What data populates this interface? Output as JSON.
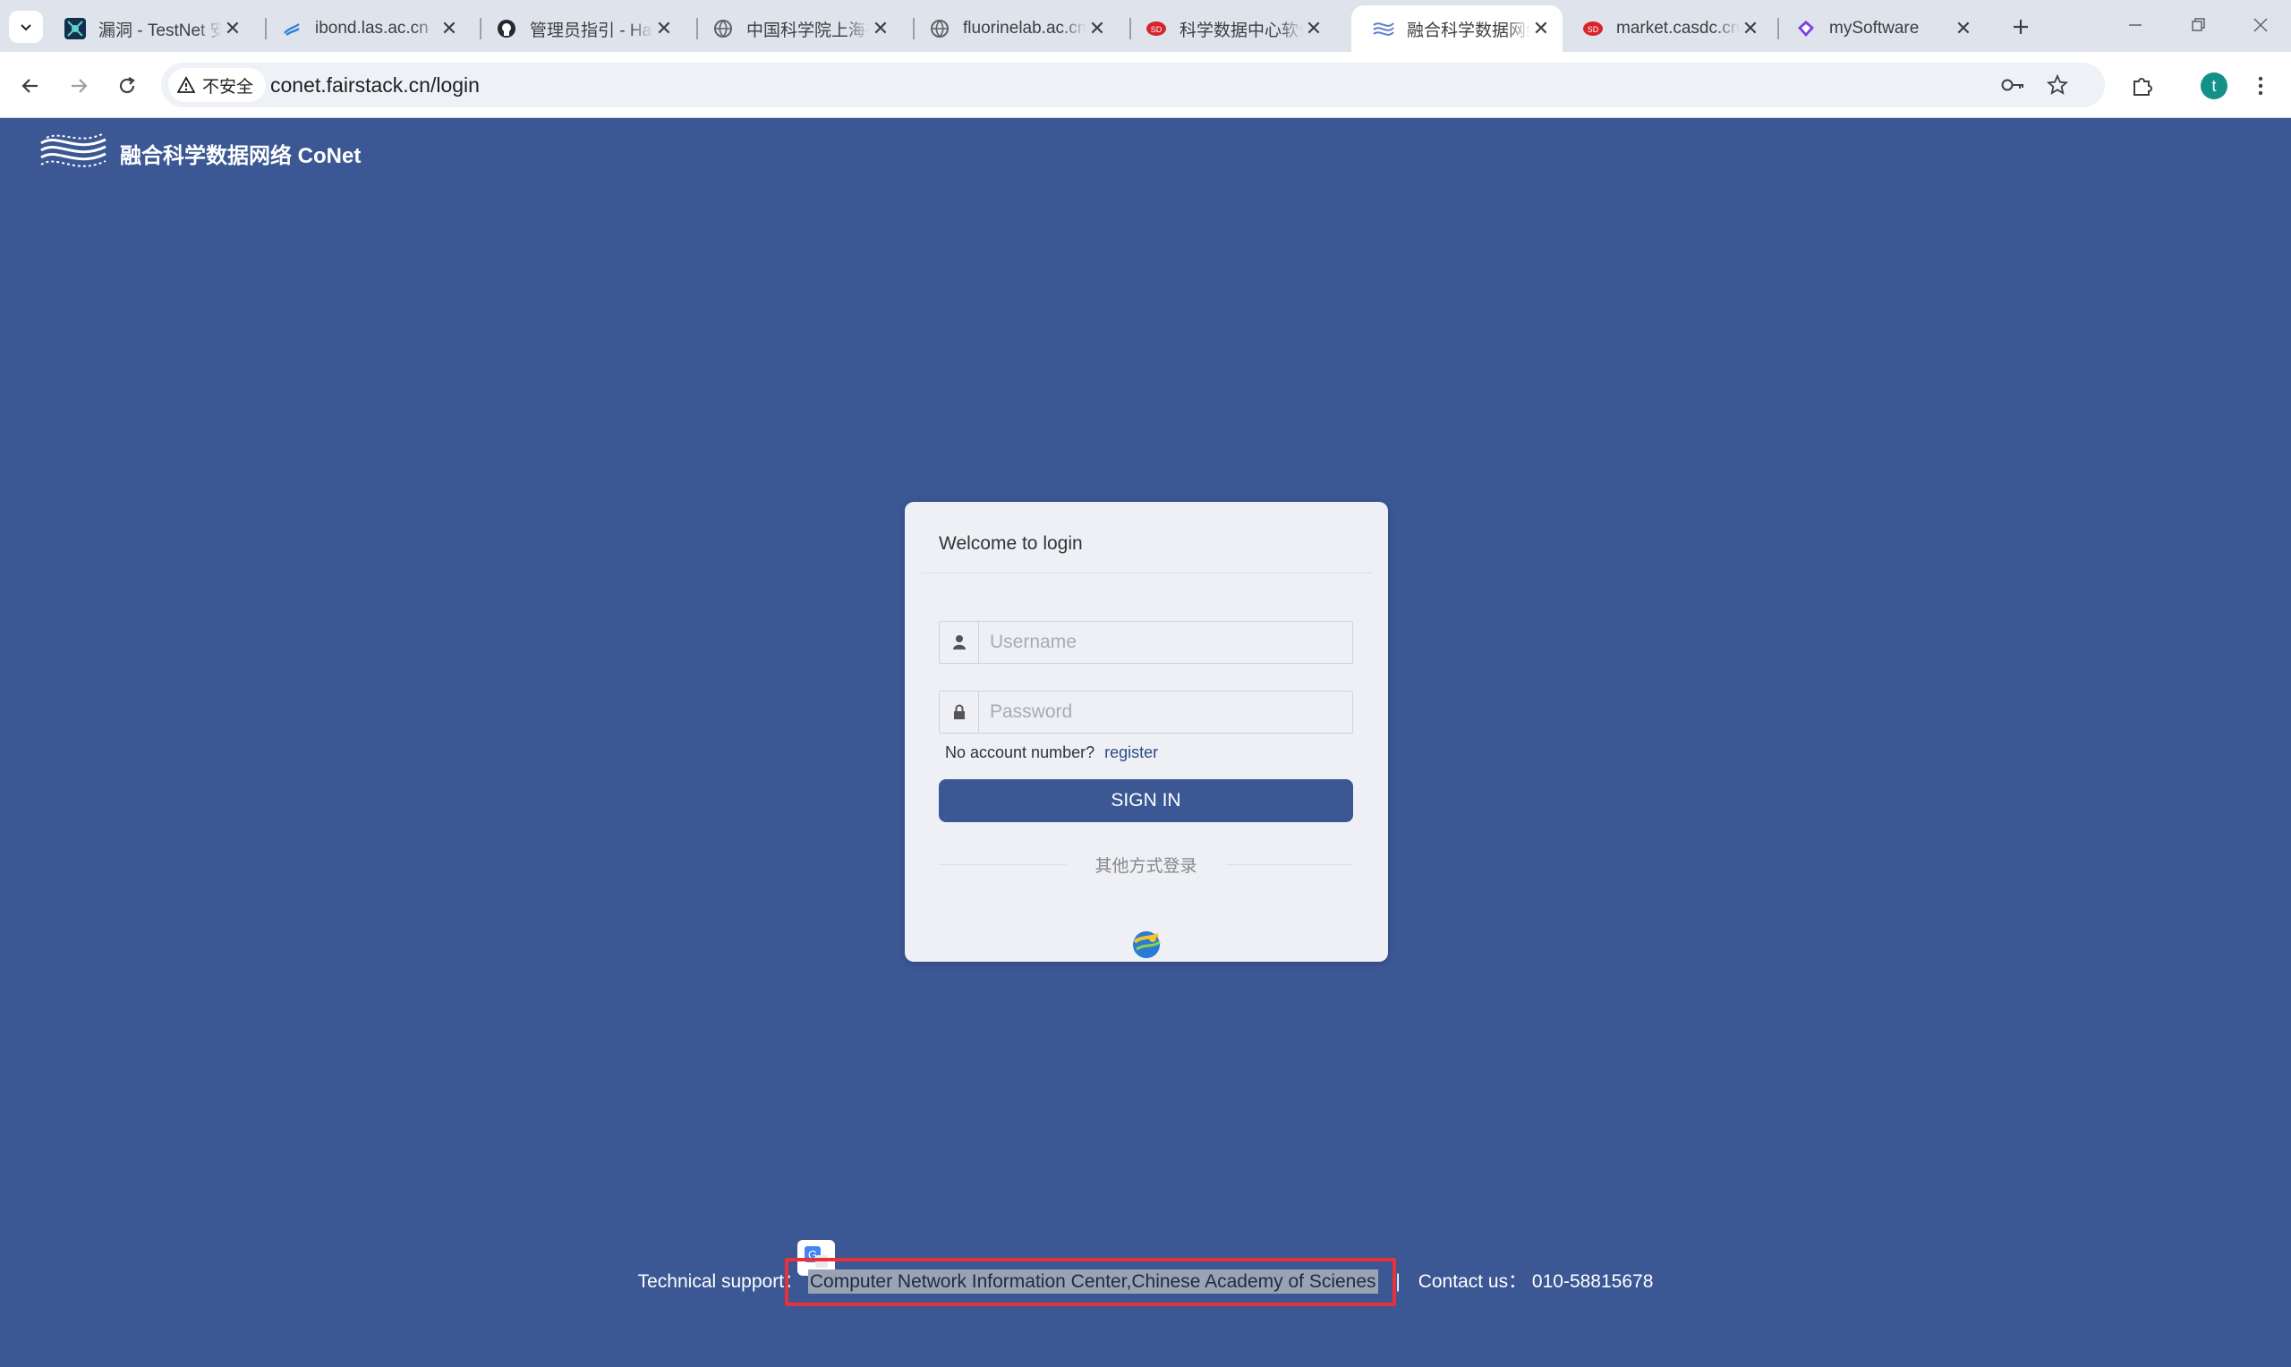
{
  "browser": {
    "tabs": [
      {
        "title": "漏洞 - TestNet 安全",
        "favicon": "testnet-favicon-icon",
        "active": false
      },
      {
        "title": "ibond.las.ac.cn",
        "favicon": "wheat-favicon-icon",
        "active": false
      },
      {
        "title": "管理员指引 - Harbor",
        "favicon": "github-favicon-icon",
        "active": false
      },
      {
        "title": "中国科学院上海有机",
        "favicon": "globe-favicon-icon",
        "active": false
      },
      {
        "title": "fluorinelab.ac.cn",
        "favicon": "globe-favicon-icon",
        "active": false
      },
      {
        "title": "科学数据中心软件",
        "favicon": "casdc-favicon-icon",
        "active": false
      },
      {
        "title": "融合科学数据网络",
        "favicon": "conet-favicon-icon",
        "active": true
      },
      {
        "title": "market.casdc.cn",
        "favicon": "casdc-favicon-icon",
        "active": false
      },
      {
        "title": "mySoftware",
        "favicon": "diamond-favicon-icon",
        "active": false
      }
    ],
    "security_label": "不安全",
    "url": "conet.fairstack.cn/login",
    "profile_initial": "t"
  },
  "page": {
    "brand_name": "融合科学数据网络 CoNet",
    "login": {
      "title": "Welcome to login",
      "username_placeholder": "Username",
      "password_placeholder": "Password",
      "no_account_text": "No account number?",
      "register_link": "register",
      "sign_in_label": "SIGN IN",
      "other_methods_label": "其他方式登录"
    },
    "footer": {
      "support_label": "Technical support：",
      "support_org": "Computer Network Information Center,Chinese Academy of Scienes",
      "separator": "|",
      "contact_label": "Contact us：",
      "contact_phone": "010-58815678"
    }
  },
  "colors": {
    "page_bg": "#3b5794",
    "card_bg": "#eef0f6",
    "button_bg": "#3b5794",
    "annotation_red": "#e8323a"
  }
}
